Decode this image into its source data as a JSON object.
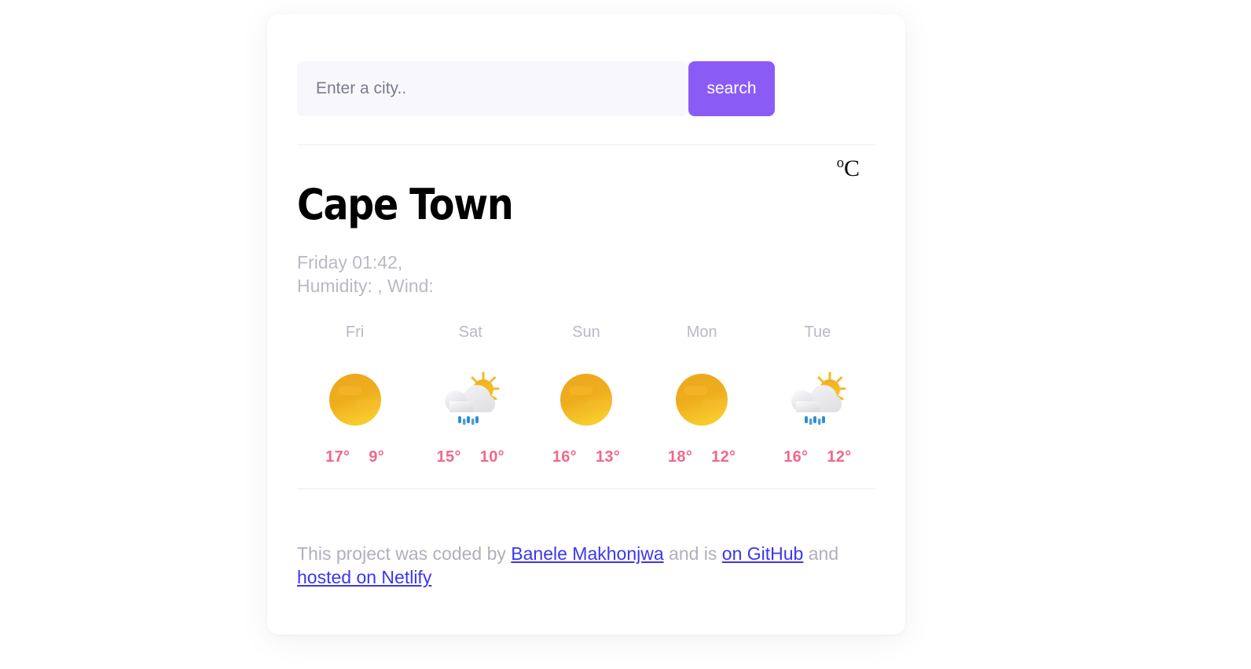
{
  "search": {
    "placeholder": "Enter a city..",
    "value": "",
    "button_label": "search"
  },
  "unit": {
    "degree": "o",
    "scale": "C"
  },
  "current": {
    "city": "Cape Town",
    "datetime": "Friday 01:42,",
    "details": "Humidity: , Wind:",
    "humidity": "",
    "wind": ""
  },
  "colors": {
    "accent": "#8a5cf5",
    "temp": "#f2678a",
    "muted": "#b9b9c6",
    "link": "#3b36f0",
    "card": "#ffffff",
    "input_bg": "#f7f7fc",
    "divider": "#ededf1"
  },
  "forecast": [
    {
      "day": "Fri",
      "icon": "sun-icon",
      "max": "17°",
      "min": "9°"
    },
    {
      "day": "Sat",
      "icon": "sun-cloud-rain-icon",
      "max": "15°",
      "min": "10°"
    },
    {
      "day": "Sun",
      "icon": "sun-icon",
      "max": "16°",
      "min": "13°"
    },
    {
      "day": "Mon",
      "icon": "sun-icon",
      "max": "18°",
      "min": "12°"
    },
    {
      "day": "Tue",
      "icon": "sun-cloud-rain-icon",
      "max": "16°",
      "min": "12°"
    }
  ],
  "footer": {
    "prefix": "This project was coded by ",
    "author": "Banele Makhonjwa",
    "middle": " and is ",
    "github": "on GitHub",
    "join": " and ",
    "netlify": "hosted on Netlify"
  }
}
